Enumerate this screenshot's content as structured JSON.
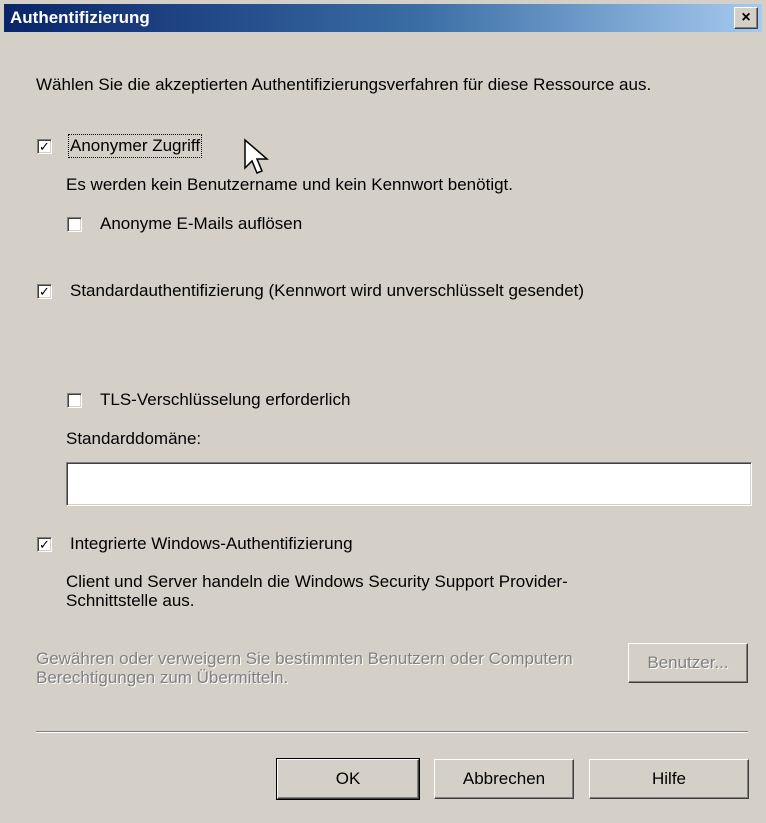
{
  "dialog": {
    "title": "Authentifizierung",
    "close_glyph": "×"
  },
  "intro": "Wählen Sie die akzeptierten Authentifizierungsverfahren für diese Ressource aus.",
  "anonymous": {
    "checked": true,
    "label": "Anonymer Zugriff",
    "description": "Es werden kein Benutzername und kein Kennwort benötigt.",
    "resolve_emails": {
      "checked": false,
      "label": "Anonyme E-Mails auflösen"
    }
  },
  "basic": {
    "checked": true,
    "label": "Standardauthentifizierung (Kennwort wird unverschlüsselt gesendet)",
    "tls": {
      "checked": false,
      "label": "TLS-Verschlüsselung erforderlich"
    },
    "default_domain_label": "Standarddomäne:",
    "default_domain_value": ""
  },
  "windows": {
    "checked": true,
    "label": "Integrierte Windows-Authentifizierung",
    "description": "Client und Server handeln die Windows Security Support Provider-Schnittstelle aus."
  },
  "permissions": {
    "text": "Gewähren oder verweigern Sie bestimmten Benutzern oder Computern Berechtigungen zum Übermitteln.",
    "button_label": "Benutzer..."
  },
  "buttons": {
    "ok": "OK",
    "cancel": "Abbrechen",
    "help": "Hilfe"
  },
  "colors": {
    "face": "#d4d0c8",
    "title_start": "#0a246a",
    "title_end": "#a6caf0"
  },
  "icons": {
    "cursor": "arrow-cursor-icon"
  }
}
